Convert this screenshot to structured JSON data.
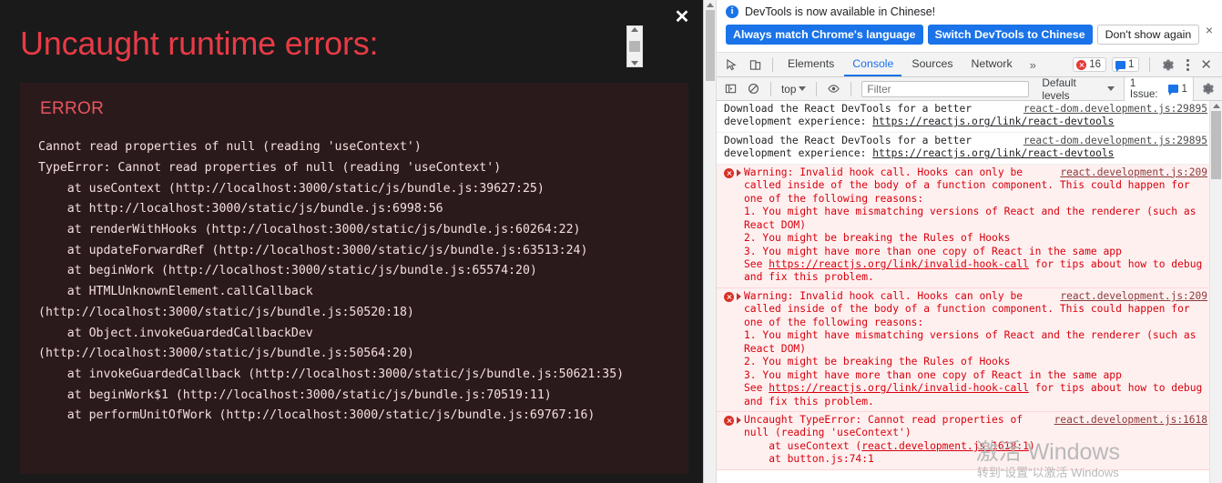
{
  "error_overlay": {
    "title": "Uncaught runtime errors:",
    "close_label": "✕",
    "error_label": "ERROR",
    "message": "Cannot read properties of null (reading 'useContext')",
    "stack": "TypeError: Cannot read properties of null (reading 'useContext')\n    at useContext (http://localhost:3000/static/js/bundle.js:39627:25)\n    at http://localhost:3000/static/js/bundle.js:6998:56\n    at renderWithHooks (http://localhost:3000/static/js/bundle.js:60264:22)\n    at updateForwardRef (http://localhost:3000/static/js/bundle.js:63513:24)\n    at beginWork (http://localhost:3000/static/js/bundle.js:65574:20)\n    at HTMLUnknownElement.callCallback (http://localhost:3000/static/js/bundle.js:50520:18)\n    at Object.invokeGuardedCallbackDev (http://localhost:3000/static/js/bundle.js:50564:20)\n    at invokeGuardedCallback (http://localhost:3000/static/js/bundle.js:50621:35)\n    at beginWork$1 (http://localhost:3000/static/js/bundle.js:70519:11)\n    at performUnitOfWork (http://localhost:3000/static/js/bundle.js:69767:16)"
  },
  "devtools": {
    "banner": {
      "info_icon": "i",
      "text": "DevTools is now available in Chinese!",
      "btn_always_match": "Always match Chrome's language",
      "btn_switch": "Switch DevTools to Chinese",
      "btn_dont_show": "Don't show again",
      "close_label": "×"
    },
    "toolbar": {
      "tabs": [
        {
          "label": "Elements",
          "active": false
        },
        {
          "label": "Console",
          "active": true
        },
        {
          "label": "Sources",
          "active": false
        },
        {
          "label": "Network",
          "active": false
        }
      ],
      "more_label": "»",
      "error_count": "16",
      "message_count": "1",
      "close_label": "✕"
    },
    "filterbar": {
      "context": "top",
      "filter_placeholder": "Filter",
      "filter_value": "",
      "levels": "Default levels",
      "issues_label": "1 Issue:",
      "issues_count": "1"
    },
    "console_messages": [
      {
        "type": "log",
        "source": "react-dom.development.js:29895",
        "text": "Download the React DevTools for a better development experience: ",
        "link": "https://reactjs.org/link/react-devtools"
      },
      {
        "type": "log",
        "source": "react-dom.development.js:29895",
        "text": "Download the React DevTools for a better development experience: ",
        "link": "https://reactjs.org/link/react-devtools"
      },
      {
        "type": "error",
        "source": "react.development.js:209",
        "text_before": "Warning: Invalid hook call. Hooks can only be called inside of the body of a function component. This could happen for one of the following reasons:\n1. You might have mismatching versions of React and the renderer (such as React DOM)\n2. You might be breaking the Rules of Hooks\n3. You might have more than one copy of React in the same app\nSee ",
        "link": "https://reactjs.org/link/invalid-hook-call",
        "text_after": " for tips about how to debug and fix this problem."
      },
      {
        "type": "error",
        "source": "react.development.js:209",
        "text_before": "Warning: Invalid hook call. Hooks can only be called inside of the body of a function component. This could happen for one of the following reasons:\n1. You might have mismatching versions of React and the renderer (such as React DOM)\n2. You might be breaking the Rules of Hooks\n3. You might have more than one copy of React in the same app\nSee ",
        "link": "https://reactjs.org/link/invalid-hook-call",
        "text_after": " for tips about how to debug and fix this problem."
      },
      {
        "type": "error",
        "source": "react.development.js:1618",
        "text_before": "Uncaught TypeError: Cannot read properties of null (reading 'useContext')\n    at useContext (",
        "link": "react.development.js:1618:1",
        "text_after": ")\n    at button.js:74:1"
      }
    ]
  },
  "watermark": {
    "line1": "激活 Windows",
    "line2": "转到“设置”以激活 Windows"
  }
}
